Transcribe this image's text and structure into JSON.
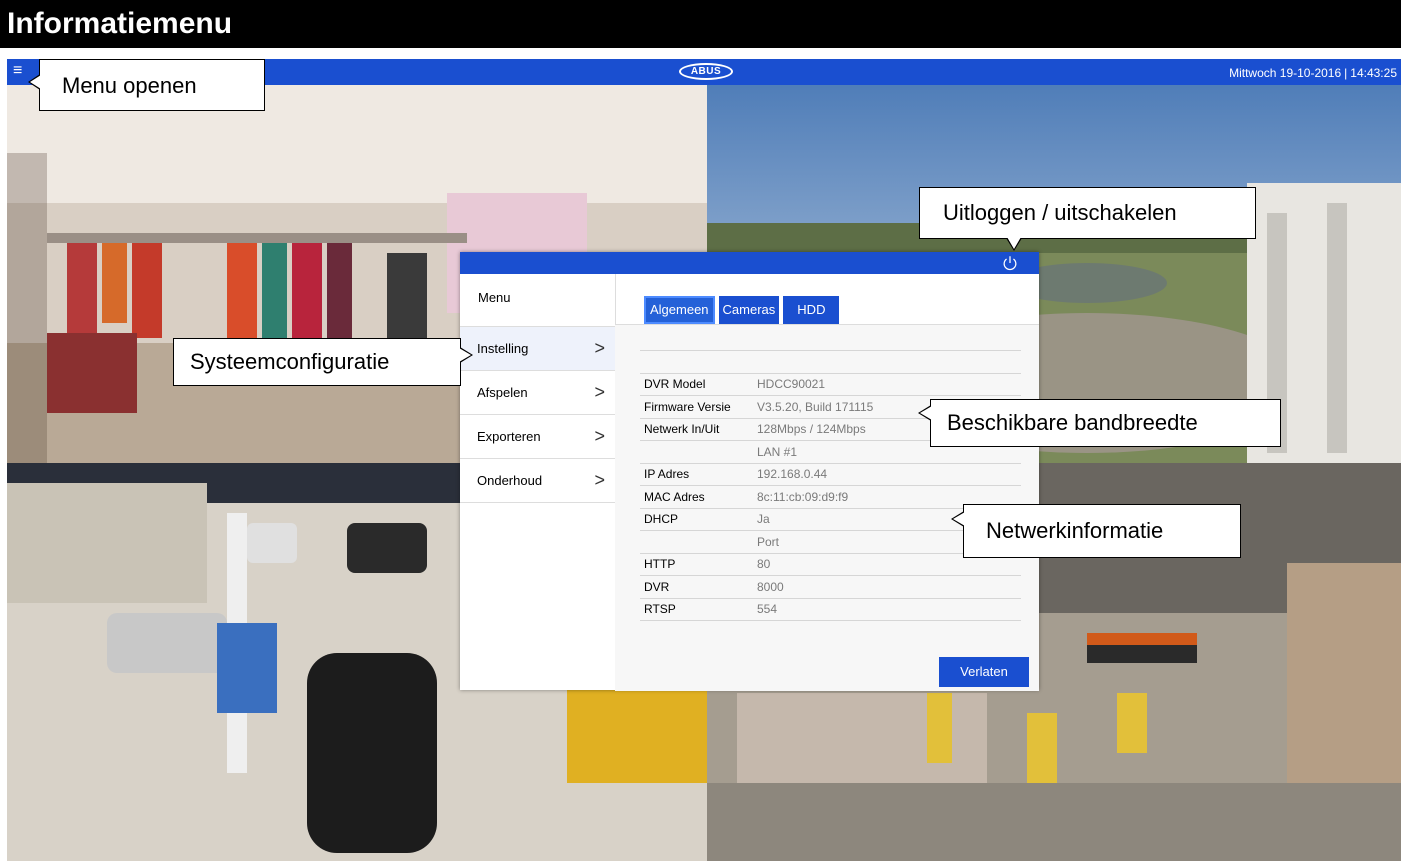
{
  "page_title": "Informatiemenu",
  "topbar": {
    "menu_icon": "hamburger-icon",
    "logo": "ABUS",
    "day": "Mittwoch 19-10-2016",
    "separator": "|",
    "time": "14:43:25",
    "color": "#1a4fd0"
  },
  "callouts": {
    "menu_open": "Menu openen",
    "logout": "Uitloggen / uitschakelen",
    "system_config": "Systeemconfiguratie",
    "bandwidth": "Beschikbare bandbreedte",
    "network": "Netwerkinformatie"
  },
  "dialog": {
    "power_icon": "power-icon",
    "sidebar_title": "Menu",
    "sidebar_items": [
      {
        "label": "Instelling",
        "chevron": ">"
      },
      {
        "label": "Afspelen",
        "chevron": ">"
      },
      {
        "label": "Exporteren",
        "chevron": ">"
      },
      {
        "label": "Onderhoud",
        "chevron": ">"
      }
    ],
    "tabs": [
      {
        "label": "Algemeen"
      },
      {
        "label": "Cameras"
      },
      {
        "label": "HDD"
      }
    ],
    "info_rows": [
      {
        "key": "",
        "value": ""
      },
      {
        "key": "DVR Model",
        "value": "HDCC90021"
      },
      {
        "key": "Firmware Versie",
        "value": "V3.5.20, Build 171115"
      },
      {
        "key": "Netwerk In/Uit",
        "value": "128Mbps / 124Mbps"
      },
      {
        "key": "",
        "value": "LAN #1"
      },
      {
        "key": "IP Adres",
        "value": "192.168.0.44"
      },
      {
        "key": "MAC Adres",
        "value": "8c:11:cb:09:d9:f9"
      },
      {
        "key": "DHCP",
        "value": "Ja"
      },
      {
        "key": "",
        "value": "Port"
      },
      {
        "key": "HTTP",
        "value": "80"
      },
      {
        "key": "DVR",
        "value": "8000"
      },
      {
        "key": "RTSP",
        "value": "554"
      }
    ],
    "exit_label": "Verlaten"
  }
}
